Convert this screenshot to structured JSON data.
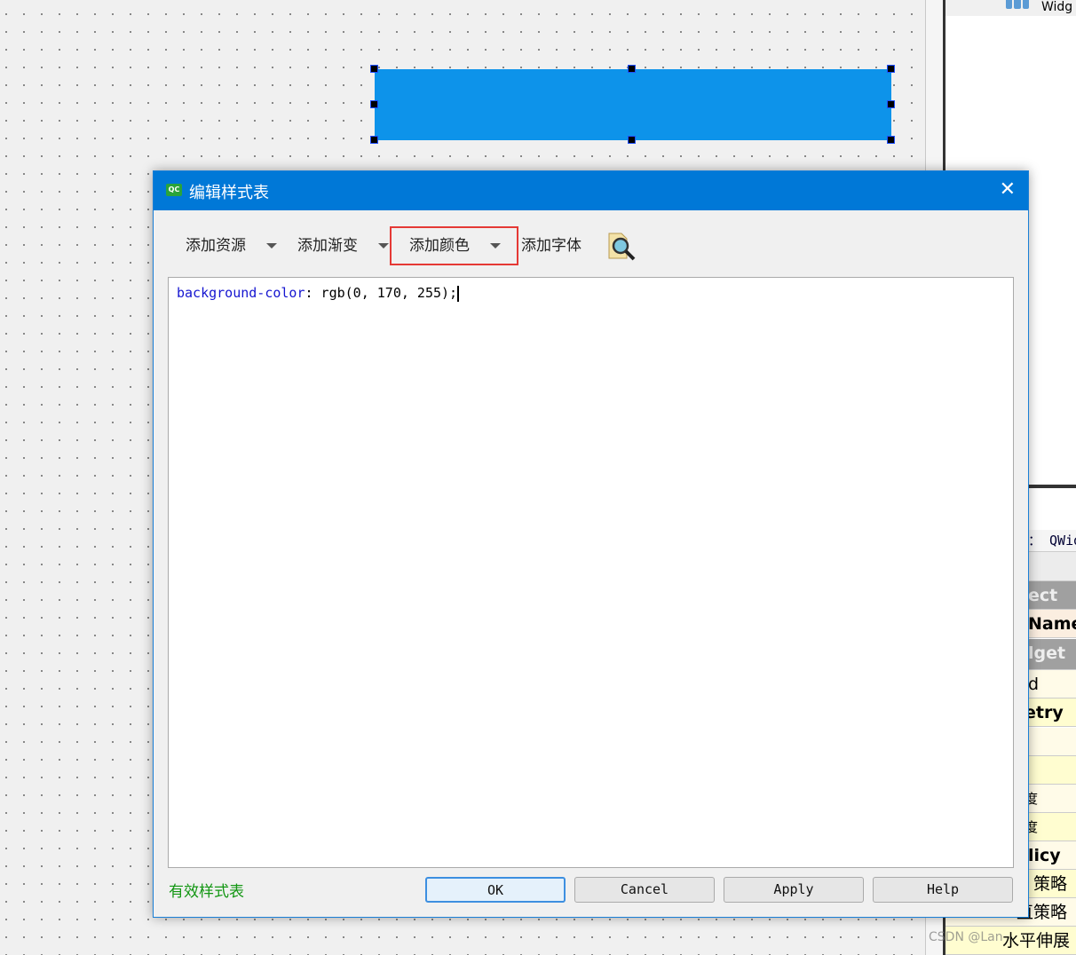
{
  "canvas": {
    "widget_color": "#0d93ea"
  },
  "right_panel": {
    "top_text": "Widg",
    "rows": [
      "： QWid",
      "",
      "ect",
      "Name",
      "lget",
      "d",
      "etry",
      "",
      "",
      "度",
      "度",
      "licy",
      "策略",
      "直策略",
      "水平伸展"
    ]
  },
  "watermark": "CSDN @Lan",
  "dialog": {
    "title": "编辑样式表",
    "app_icon": "QC",
    "toolbar": {
      "add_resource": "添加资源",
      "add_gradient": "添加渐变",
      "add_color": "添加颜色",
      "add_font": "添加字体"
    },
    "editor": {
      "property": "background-color",
      "value": ": rgb(0, 170, 255);"
    },
    "status": "有效样式表",
    "buttons": {
      "ok": "OK",
      "cancel": "Cancel",
      "apply": "Apply",
      "help": "Help"
    },
    "colors": {
      "title_bar": "#0078d7",
      "highlight_box": "#e53935",
      "valid": "#129612"
    }
  }
}
